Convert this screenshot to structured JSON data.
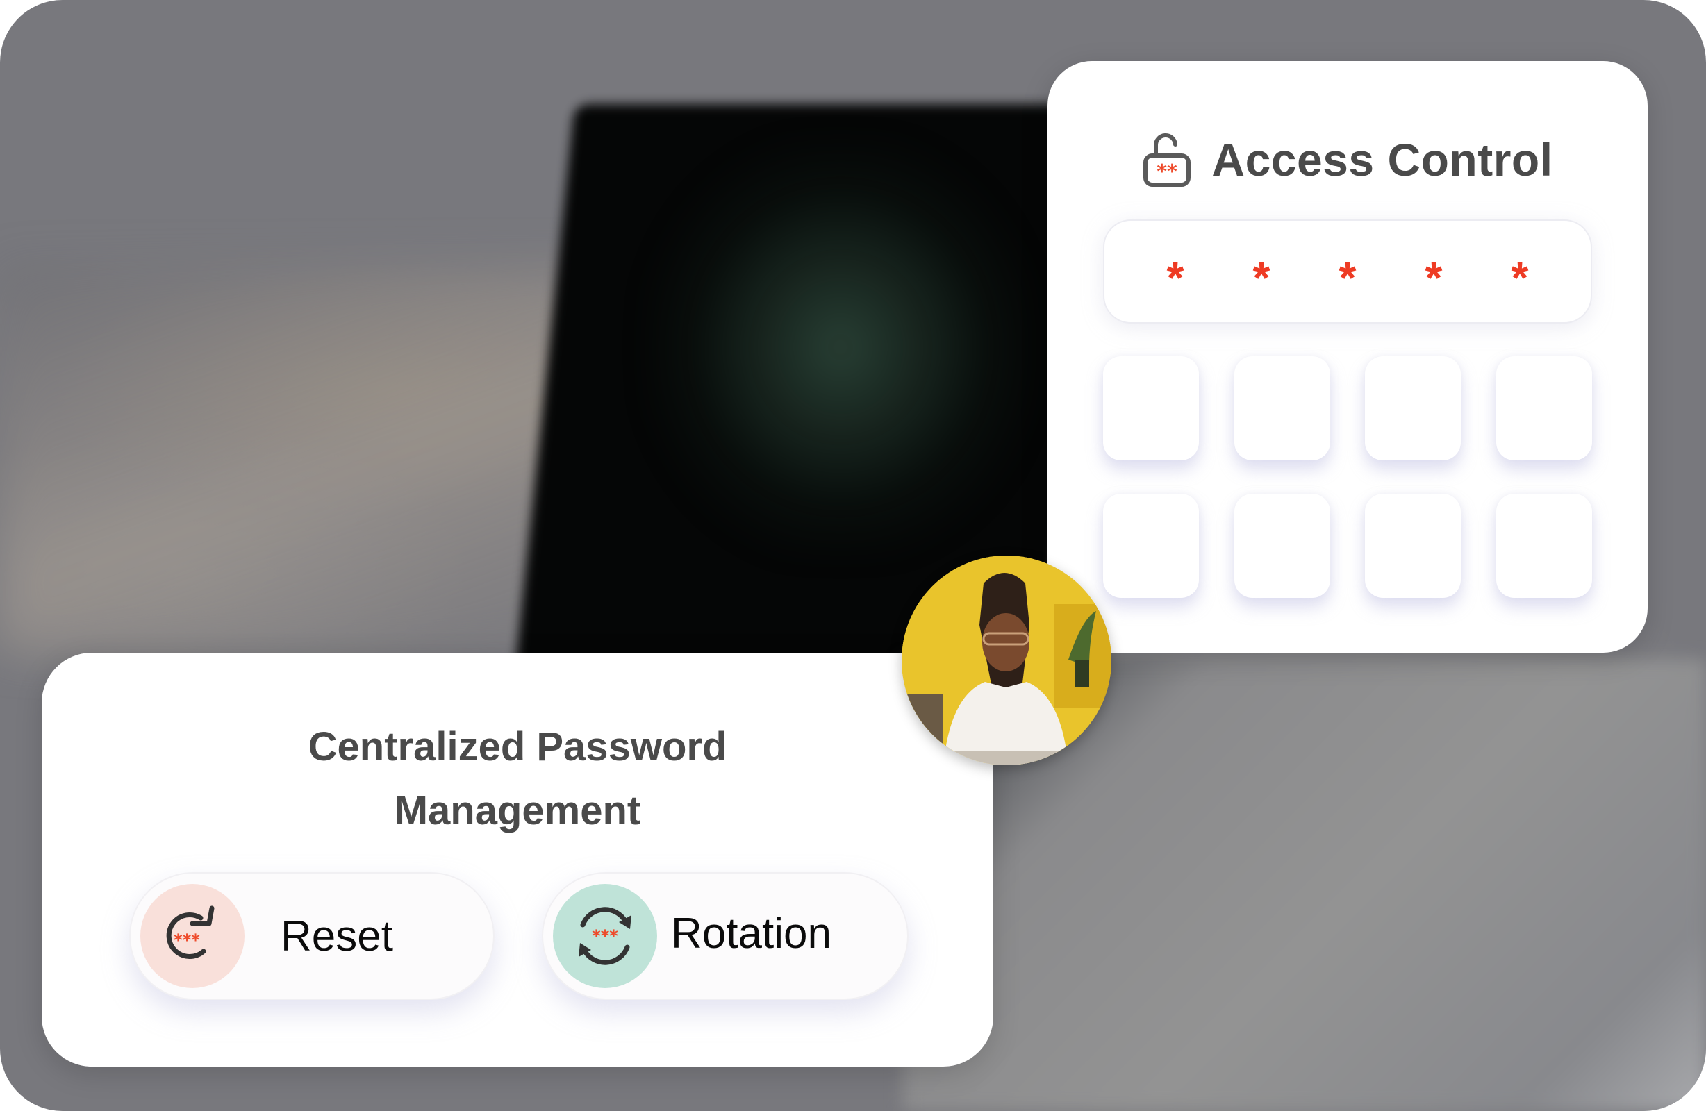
{
  "background": {
    "description": "blurred photo of laptop on desk"
  },
  "access_control": {
    "title": "Access Control",
    "icon": "unlocked-padlock-icon",
    "pin_chars": [
      "*",
      "*",
      "*",
      "*",
      "*"
    ],
    "pin_length": 5,
    "keypad_rows": 2,
    "keypad_cols": 4,
    "keypad_keys": [
      "",
      "",
      "",
      "",
      "",
      "",
      "",
      ""
    ]
  },
  "avatar": {
    "alt": "Woman with glasses and braided hair in white shirt against yellow wall"
  },
  "password_management": {
    "title_line1": "Centralized Password",
    "title_line2": "Management",
    "actions": [
      {
        "label": "Reset",
        "icon": "reset-arrow-icon",
        "icon_badge": "***",
        "icon_bg": "#f9e0da"
      },
      {
        "label": "Rotation",
        "icon": "rotation-arrows-icon",
        "icon_badge": "***",
        "icon_bg": "#bfe3d8"
      }
    ]
  },
  "colors": {
    "accent_red": "#ee3b24",
    "title_gray": "#4a4a4a",
    "icon_dark": "#333333"
  }
}
